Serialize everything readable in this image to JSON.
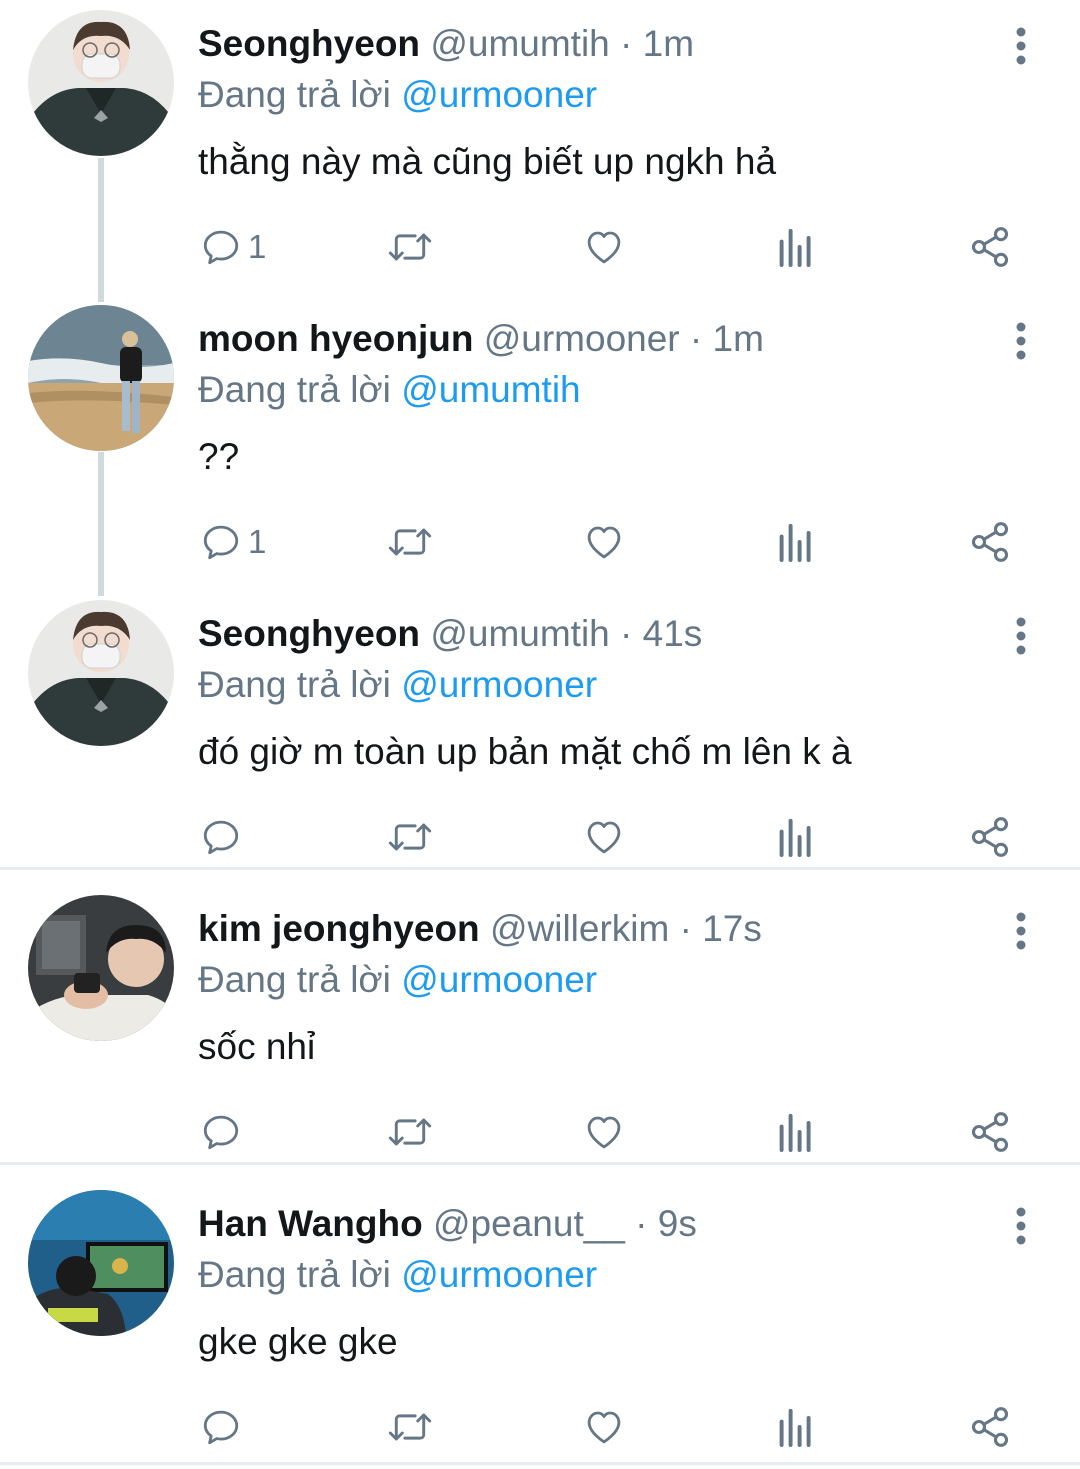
{
  "tweets": [
    {
      "name": "Seonghyeon",
      "handle": "@umumtih",
      "dot": "·",
      "time": "1m",
      "replying_label": "Đang trả lời",
      "replying_to": "@urmooner",
      "text": "thằng này mà cũng biết up ngkh hả",
      "reply_count": "1",
      "avatar": "masked-person-avatar"
    },
    {
      "name": "moon hyeonjun",
      "handle": "@urmooner",
      "dot": "·",
      "time": "1m",
      "replying_label": "Đang trả lời",
      "replying_to": "@umumtih",
      "text": "??",
      "reply_count": "1",
      "avatar": "beach-person-avatar"
    },
    {
      "name": "Seonghyeon",
      "handle": "@umumtih",
      "dot": "·",
      "time": "41s",
      "replying_label": "Đang trả lời",
      "replying_to": "@urmooner",
      "text": "đó giờ m toàn up bản mặt chố m lên k à",
      "reply_count": "",
      "avatar": "masked-person-avatar"
    },
    {
      "name": "kim jeonghyeon",
      "handle": "@willerkim",
      "dot": "·",
      "time": "17s",
      "replying_label": "Đang trả lời",
      "replying_to": "@urmooner",
      "text": "sốc nhỉ",
      "reply_count": "",
      "avatar": "gym-person-avatar"
    },
    {
      "name": "Han Wangho",
      "handle": "@peanut__",
      "dot": "·",
      "time": "9s",
      "replying_label": "Đang trả lời",
      "replying_to": "@urmooner",
      "text": "gke gke gke",
      "reply_count": "",
      "avatar": "gamer-person-avatar"
    }
  ],
  "icons": {
    "reply": "reply-icon",
    "retweet": "retweet-icon",
    "like": "heart-icon",
    "views": "analytics-icon",
    "share": "share-icon",
    "more": "more-vertical-icon"
  },
  "colors": {
    "name": "#14171a",
    "secondary": "#657786",
    "mention": "#1d9bf0",
    "thread_line": "#cfd9de",
    "divider": "#e6ecf0"
  }
}
